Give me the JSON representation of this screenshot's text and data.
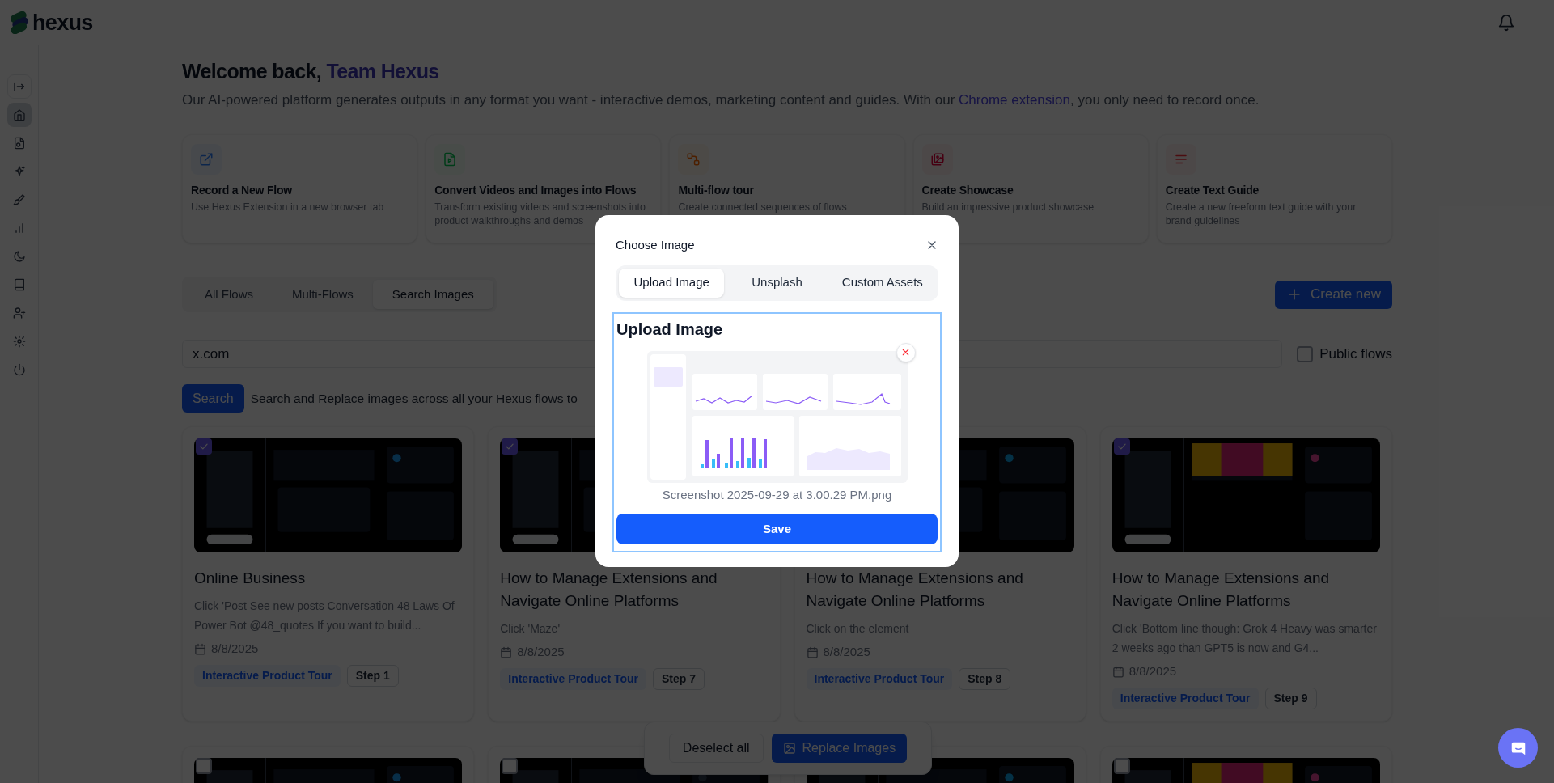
{
  "app": {
    "name": "hexus"
  },
  "sidebar": {
    "items": [
      {
        "selected": false
      },
      {
        "selected": true
      },
      {
        "selected": false
      },
      {
        "selected": false
      },
      {
        "selected": false
      },
      {
        "selected": false
      },
      {
        "selected": false
      },
      {
        "selected": false
      },
      {
        "selected": false
      },
      {
        "selected": false
      },
      {
        "selected": false
      }
    ]
  },
  "welcome": {
    "greeting": "Welcome back,",
    "name": "Team Hexus"
  },
  "intro": {
    "text": "Our AI-powered platform generates outputs in any format you want - interactive demos, marketing content and guides. With our",
    "link": "Chrome extension",
    "after": ", you only need to record once."
  },
  "actions": [
    {
      "title": "Record a New Flow",
      "description": "Use Hexus Extension in a new browser tab"
    },
    {
      "title": "Convert Videos and Images into Flows",
      "description": "Transform existing videos and screenshots into product walkthroughs and demos"
    },
    {
      "title": "Multi-flow tour",
      "description": "Create connected sequences of flows"
    },
    {
      "title": "Create Showcase",
      "description": "Build an impressive product showcase"
    },
    {
      "title": "Create Text Guide",
      "description": "Create a new freeform text guide with your brand guidelines"
    }
  ],
  "tabs": [
    {
      "label": "All Flows",
      "selected": false
    },
    {
      "label": "Multi-Flows",
      "selected": false
    },
    {
      "label": "Search Images",
      "selected": true
    }
  ],
  "create_button": "Create new",
  "search": {
    "value": "x.com"
  },
  "public_flows": {
    "label": "Public flows",
    "checked": false
  },
  "search_button": "Search",
  "search_hint": "Search and Replace images across all your Hexus flows to",
  "flows": [
    {
      "checked": true,
      "image": {
        "kind": "picture"
      },
      "title": "Online Business",
      "description": "Click 'Post See new posts Conversation 48 Laws Of Power Bot @48_quotes If you want to build...",
      "date": "8/8/2025",
      "tag": "Interactive Product Tour",
      "step": "Step 1"
    },
    {
      "checked": true,
      "image": {
        "kind": "picture"
      },
      "title": "How to Manage Extensions and Navigate Online Platforms",
      "description": "Click 'Maze'",
      "date": "8/8/2025",
      "tag": "Interactive Product Tour",
      "step": "Step 7"
    },
    {
      "image": {
        "kind": "picture"
      },
      "title": "How to Manage Extensions and Navigate Online Platforms",
      "description": "Click on the element",
      "date": "8/8/2025",
      "tag": "Interactive Product Tour",
      "step": "Step 8"
    },
    {
      "checked": true,
      "image": {
        "kind": "picture"
      },
      "title": "How to Manage Extensions and Navigate Online Platforms",
      "description": "Click 'Bottom line though: Grok 4 Heavy was smarter 2 weeks ago than GPT5 is now and G4...",
      "date": "8/8/2025",
      "tag": "Interactive Product Tour",
      "step": "Step 9"
    },
    {
      "checked": false,
      "image": {
        "kind": "picture"
      }
    },
    {
      "checked": false,
      "image": {
        "kind": "picture"
      }
    },
    {
      "image": {
        "kind": "picture"
      }
    },
    {
      "checked": false,
      "image": {
        "kind": "picture"
      }
    }
  ],
  "bulk_bar": {
    "deselect": "Deselect all",
    "replace": "Replace Images"
  },
  "modal": {
    "title": "Choose Image",
    "tabs": [
      {
        "label": "Upload Image",
        "selected": true
      },
      {
        "label": "Unsplash",
        "selected": false
      },
      {
        "label": "Custom Assets",
        "selected": false
      }
    ],
    "section_title": "Upload Image",
    "preview": {
      "kind": "picture"
    },
    "file_name": "Screenshot 2025-09-29 at 3.00.29 PM.png",
    "save": "Save"
  }
}
